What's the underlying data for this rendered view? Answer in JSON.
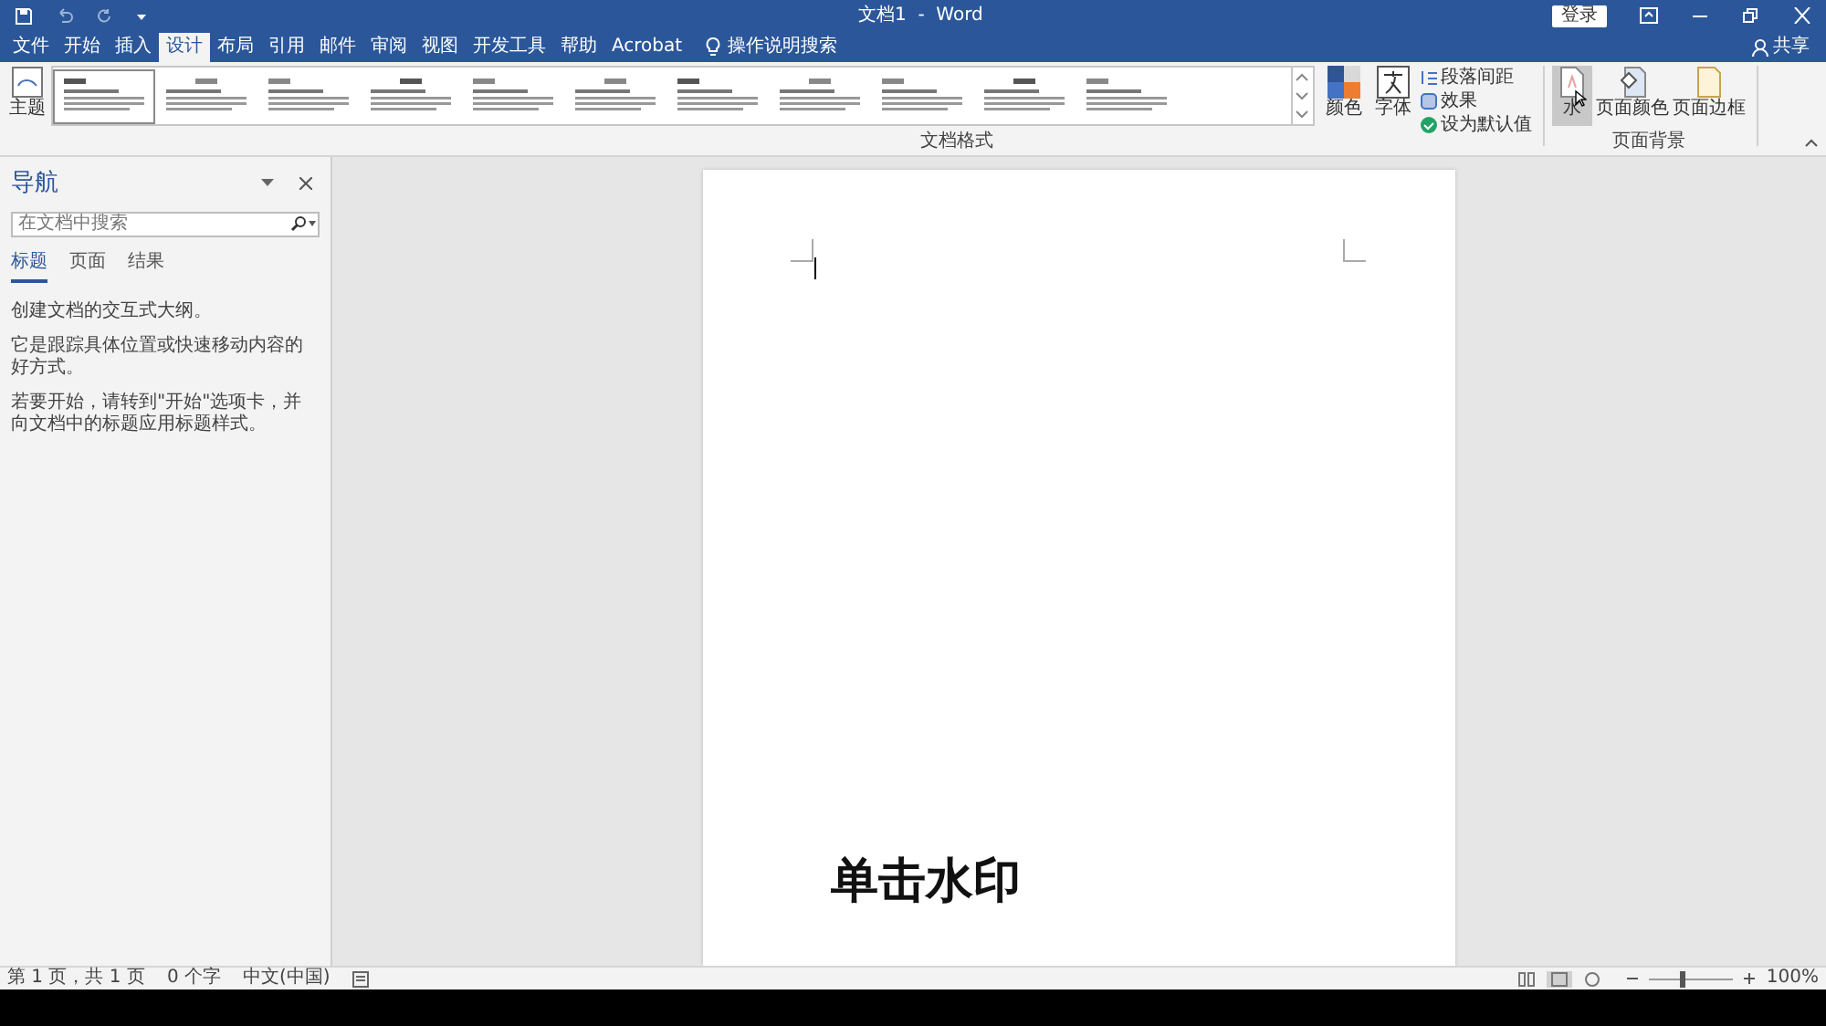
{
  "title_bar": {
    "title": "文档1  -  Word",
    "login": "登录"
  },
  "ribbon_tabs": [
    {
      "label": "文件",
      "selected": false
    },
    {
      "label": "开始",
      "selected": false
    },
    {
      "label": "插入",
      "selected": false
    },
    {
      "label": "设计",
      "selected": true
    },
    {
      "label": "布局",
      "selected": false
    },
    {
      "label": "引用",
      "selected": false
    },
    {
      "label": "邮件",
      "selected": false
    },
    {
      "label": "审阅",
      "selected": false
    },
    {
      "label": "视图",
      "selected": false
    },
    {
      "label": "开发工具",
      "selected": false
    },
    {
      "label": "帮助",
      "selected": false
    },
    {
      "label": "Acrobat",
      "selected": false
    }
  ],
  "tell_me": "操作说明搜索",
  "share": "共享",
  "ribbon": {
    "theme": "主题",
    "styles": [
      {
        "selected": true
      },
      {
        "selected": false
      },
      {
        "selected": false
      },
      {
        "selected": false
      },
      {
        "selected": false
      },
      {
        "selected": false
      },
      {
        "selected": false
      },
      {
        "selected": false
      },
      {
        "selected": false
      },
      {
        "selected": false
      },
      {
        "selected": false
      }
    ],
    "colors": "颜色",
    "fonts": "字体",
    "paragraph_spacing": "段落间距",
    "effects": "效果",
    "set_default": "设为默认值",
    "group_document_format": "文档格式",
    "watermark": {
      "label": "水",
      "selected": true
    },
    "page_color": "页面颜色",
    "page_borders": "页面边框",
    "group_page_background": "页面背景"
  },
  "navigation": {
    "title": "导航",
    "search": {
      "placeholder": "在文档中搜索"
    },
    "tabs": [
      {
        "label": "标题",
        "selected": true
      },
      {
        "label": "页面",
        "selected": false
      },
      {
        "label": "结果",
        "selected": false
      }
    ],
    "paragraphs": [
      "创建文档的交互式大纲。",
      "它是跟踪具体位置或快速移动内容的好方式。",
      "若要开始，请转到\"开始\"选项卡，并向文档中的标题应用标题样式。"
    ]
  },
  "caption": "单击水印",
  "status_bar": {
    "items": [
      "第 1 页，共 1 页",
      "0 个字",
      "中文(中国)"
    ],
    "zoom": {
      "level": 0.35,
      "reading": "100%"
    }
  }
}
